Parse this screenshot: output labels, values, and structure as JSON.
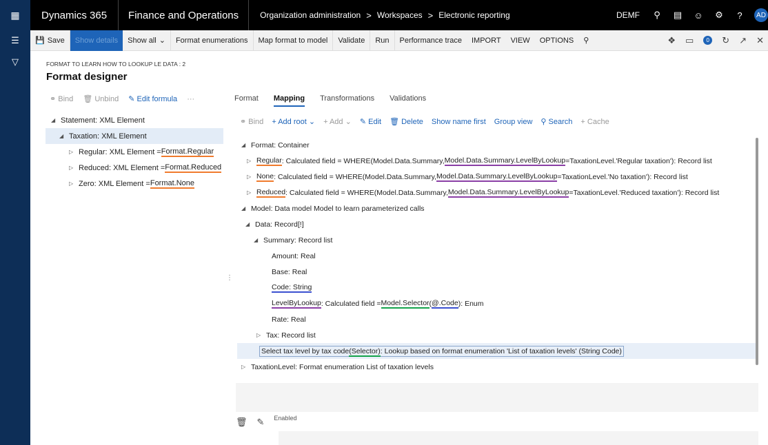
{
  "topbar": {
    "waffle_icon": "waffle-icon",
    "brand": "Dynamics 365",
    "app": "Finance and Operations",
    "breadcrumbs": [
      "Organization administration",
      "Workspaces",
      "Electronic reporting"
    ],
    "separator": ">",
    "company": "DEMF",
    "avatar": "AD",
    "icons": [
      "search-icon",
      "chat-icon",
      "smiley-icon",
      "gear-icon",
      "help-icon"
    ]
  },
  "actionbar": {
    "save": "Save",
    "show_details": "Show details",
    "show_all": "Show all",
    "format_enumerations": "Format enumerations",
    "map_format_to_model": "Map format to model",
    "validate": "Validate",
    "run": "Run",
    "performance_trace": "Performance trace",
    "import": "IMPORT",
    "view": "VIEW",
    "options": "OPTIONS",
    "notif_count": "0"
  },
  "page": {
    "caption": "FORMAT TO LEARN HOW TO LOOKUP LE DATA : 2",
    "title": "Format designer"
  },
  "left_toolbar": {
    "bind": "Bind",
    "unbind": "Unbind",
    "edit_formula": "Edit formula",
    "more": "···"
  },
  "format_tree": [
    {
      "label": "Statement: XML Element"
    },
    {
      "label": "Taxation: XML Element"
    },
    {
      "label": "Regular: XML Element = ",
      "bind": "Format.Regular"
    },
    {
      "label": "Reduced: XML Element = ",
      "bind": "Format.Reduced"
    },
    {
      "label": "Zero: XML Element = ",
      "bind": "Format.None"
    }
  ],
  "tabs": [
    "Format",
    "Mapping",
    "Transformations",
    "Validations"
  ],
  "mapping_toolbar": {
    "bind": "Bind",
    "add_root": "Add root",
    "add": "Add",
    "edit": "Edit",
    "delete": "Delete",
    "show_name_first": "Show name first",
    "group_view": "Group view",
    "search": "Search",
    "cache": "Cache"
  },
  "mapping_tree": {
    "format_container": "Format: Container",
    "regular_name": "Regular",
    "regular_mid": ": Calculated field = WHERE(Model.Data.Summary, ",
    "regular_expr": "Model.Data.Summary.LevelByLookup",
    "regular_tail": "=TaxationLevel.'Regular taxation'): Record list",
    "none_name": "None",
    "none_mid": ": Calculated field = WHERE(Model.Data.Summary, ",
    "none_expr": "Model.Data.Summary.LevelByLookup",
    "none_tail": "=TaxationLevel.'No taxation'): Record list",
    "reduced_name": "Reduced",
    "reduced_mid": ": Calculated field = WHERE(Model.Data.Summary, ",
    "reduced_expr": "Model.Data.Summary.LevelByLookup",
    "reduced_tail": "=TaxationLevel.'Reduced taxation'): Record list",
    "model": "Model: Data model Model to learn parameterized calls",
    "data": "Data: Record[!]",
    "summary": "Summary: Record list",
    "amount": "Amount: Real",
    "base": "Base: Real",
    "code": "Code: String",
    "lbl_name": "LevelByLookup",
    "lbl_mid": ": Calculated field = ",
    "lbl_sel": "Model.Selector",
    "lbl_open": "(",
    "lbl_code": "@.Code",
    "lbl_tail": "): Enum",
    "rate": "Rate: Real",
    "tax": "Tax: Record list",
    "select_pre": "Select tax level by tax code",
    "select_sel": "(Selector)",
    "select_tail": ": Lookup based on format enumeration 'List of taxation levels' (String Code)",
    "taxation_level": "TaxationLevel: Format enumeration List of taxation levels"
  },
  "bottom": {
    "enabled_label": "Enabled"
  }
}
